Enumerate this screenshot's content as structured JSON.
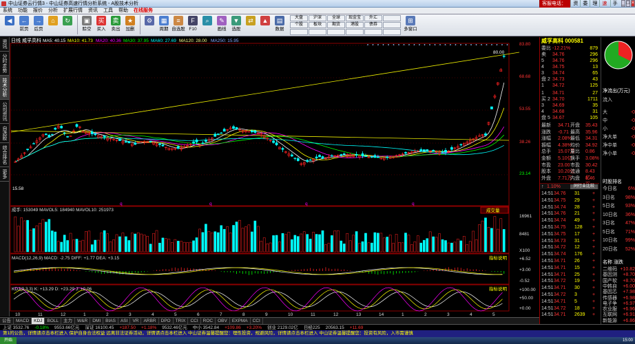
{
  "window": {
    "title": "中山证券云行情3 - 中山证券高速行情分析系统 - A股技术分析",
    "phone": "客服电话：4001022011",
    "links": [
      "资讯",
      "委托",
      "理财",
      "速帝盲盘",
      "手机炒股"
    ]
  },
  "menu": [
    "系统",
    "功能",
    "报价",
    "分析",
    "扩展行情",
    "资讯",
    "工具",
    "帮助",
    "在线服务"
  ],
  "toolbar": {
    "buttons": [
      "",
      "前页",
      "后页",
      "",
      "",
      "赊空",
      "买入",
      "卖出",
      "加删",
      "",
      "周期",
      "自选股",
      "F10",
      "",
      "画线",
      "选股",
      "",
      "",
      "数据"
    ],
    "grid": [
      "大盘",
      "沪深",
      "全球",
      "现金宝",
      "外汇",
      "",
      "个股",
      "板块",
      "期货",
      "港股",
      "债券",
      "",
      "",
      "",
      "",
      "",
      "",
      ""
    ],
    "extra": [
      "多窗口"
    ]
  },
  "leftnav": [
    "分时走势",
    "技术分析",
    "公司资讯",
    "自选股",
    "综合排名",
    "更多",
    "资讯"
  ],
  "header": {
    "period": "日线",
    "name": "威孚高科",
    "ma5": "MA5: 40.15",
    "ma10": "MA10: 41.73",
    "ma20": "MA20: 40.36",
    "ma30": "MA30: 37.95",
    "ma60": "MA60: 27.69",
    "ma120": "MA120: 28.00",
    "ma250": "MA250: 15.95"
  },
  "price_axis": [
    "83.80",
    "80.00",
    "68.68",
    "53.55",
    "38.26",
    "23.14"
  ],
  "price_marks": {
    "high": "80.00",
    "low": "15.58"
  },
  "vol_panel": {
    "header": "成手: 153049  MAVOL5: 184940  MAVOL10: 251973",
    "axis": [
      "16961",
      "8481",
      "X100"
    ],
    "tag": "成交量"
  },
  "macd_panel": {
    "header": "MACD(12,26,9)  MACD: -2.75  DIFF: +1.77  DEA: +3.15",
    "axis": [
      "+6.52",
      "+3.00",
      "-0.52"
    ],
    "tag": "指标说明"
  },
  "kdj_panel": {
    "header": "KDJ(9,3,3)  K: +13.29  D: +23.29  J: +0.06",
    "axis": [
      "+100.00",
      "+50.00",
      "+0.00"
    ],
    "tag": "指标说明"
  },
  "date_axis": [
    "10",
    "11",
    "12",
    "1",
    "2",
    "3",
    "4",
    "5",
    "6",
    "7",
    "8",
    "9",
    "10",
    "11",
    "12",
    "13",
    "14",
    "1",
    "2",
    "3",
    "4",
    "5"
  ],
  "q_marks": [
    "q",
    "q",
    "q",
    "q"
  ],
  "bottom_tabs": [
    "公告",
    "MACD",
    "KDJ",
    "BOLL",
    "主力",
    "W&R",
    "DMI",
    "BIAS",
    "ASI",
    "VR",
    "ARBR",
    "DPO",
    "TRIX",
    "CCI",
    "ROC",
    "OBV",
    "EXPMA",
    "CCI"
  ],
  "active_tab": "KDJ",
  "quote": {
    "title": "威孚高科 000581",
    "ratio_label": "委比",
    "ratio": "-12.21%",
    "diff": "879",
    "sell": [
      {
        "l": "卖",
        "p": "34.76",
        "v": "296"
      },
      {
        "l": "5",
        "p": "34.76",
        "v": "296"
      },
      {
        "l": "4",
        "p": "34.75",
        "v": "13"
      },
      {
        "l": "3",
        "p": "34.74",
        "v": "65"
      },
      {
        "l": "盘 2",
        "p": "34.73",
        "v": "43"
      },
      {
        "l": "1",
        "p": "34.72",
        "v": "125"
      }
    ],
    "buy": [
      {
        "l": "1",
        "p": "34.71",
        "v": "27"
      },
      {
        "l": "买 2",
        "p": "34.70",
        "v": "1711"
      },
      {
        "l": "3",
        "p": "34.69",
        "v": "35"
      },
      {
        "l": "4",
        "p": "34.68",
        "v": "31"
      },
      {
        "l": "盘 5",
        "p": "34.67",
        "v": "105"
      }
    ],
    "stats": [
      [
        "最新",
        "34.71",
        "开盘",
        "35.43"
      ],
      [
        "涨跌",
        "-0.71",
        "最高",
        "35.96"
      ],
      [
        "涨幅",
        "2.08%",
        "最低",
        "34.31"
      ],
      [
        "振幅",
        "4.38%",
        "均价",
        "34.92"
      ],
      [
        "总手",
        "15.07万",
        "量比",
        "0.86"
      ],
      [
        "金额",
        "5.10亿",
        "换手",
        "3.08%"
      ],
      [
        "市盈",
        "23.00",
        "市盈",
        "30.42"
      ],
      [
        "股本",
        "10.20亿",
        "流通",
        "8.43亿"
      ],
      [
        "外盘",
        "7.71万",
        "内盘",
        "8.46万"
      ]
    ],
    "bar_text": "1.10%",
    "ind_btn": "同行业比较",
    "ticks": [
      [
        "14:51",
        "34.76",
        "31",
        "+"
      ],
      [
        "14:51",
        "34.75",
        "29",
        "+"
      ],
      [
        "14:51",
        "34.74",
        "28",
        "+"
      ],
      [
        "14:51",
        "34.76",
        "21",
        "+"
      ],
      [
        "14:51",
        "34.74",
        "49",
        "+"
      ],
      [
        "14:51",
        "34.75",
        "128",
        "+"
      ],
      [
        "14:51",
        "34.75",
        "17",
        "+"
      ],
      [
        "14:51",
        "34.73",
        "31",
        "+"
      ],
      [
        "14:51",
        "34.72",
        "12",
        "+"
      ],
      [
        "14:51",
        "34.74",
        "176",
        "+"
      ],
      [
        "14:51",
        "34.71",
        "26",
        "+"
      ],
      [
        "14:51",
        "34.71",
        "15",
        "+"
      ],
      [
        "14:51",
        "34.71",
        "25",
        "+"
      ],
      [
        "14:51",
        "34.72",
        "19",
        "+"
      ],
      [
        "14:51",
        "34.71",
        "30",
        "+"
      ],
      [
        "14:51",
        "34.72",
        "3",
        "+"
      ],
      [
        "14:51",
        "34.71",
        "5",
        "+"
      ],
      [
        "14:51",
        "34.72",
        "18",
        "+"
      ],
      [
        "14:51",
        "34.71",
        "2639",
        "+"
      ]
    ]
  },
  "rightpanel": {
    "flow_title": "净流出(万元)",
    "flow_sub": "流入",
    "flow": [
      [
        "大",
        "-0"
      ],
      [
        "中",
        "-0"
      ],
      [
        "小",
        "-0"
      ],
      [
        "净大单",
        "-0"
      ],
      [
        "净中单",
        "-0"
      ],
      [
        "净小单",
        "-0"
      ]
    ],
    "rank_title": "时股排名",
    "ranks": [
      [
        "今日名",
        "6%"
      ],
      [
        "3日名",
        "98%"
      ],
      [
        "5日名",
        "93%"
      ],
      [
        "10日名",
        "36%"
      ],
      [
        "3日名",
        "47%"
      ],
      [
        "5日名",
        "71%"
      ],
      [
        "10日名",
        "99%"
      ],
      [
        "20日名",
        "52%"
      ]
    ],
    "plates_title": "名称 涨跌",
    "plates": [
      [
        "二维码",
        "+10.82"
      ],
      [
        "基因测",
        "+8.70"
      ],
      [
        "国产软",
        "+8.70"
      ],
      [
        "中韩自",
        "+6.00"
      ],
      [
        "基因芯",
        "+7.98"
      ],
      [
        "传感器",
        "+6.98"
      ],
      [
        "电子争",
        "+6.97"
      ],
      [
        "农业服",
        "+6.96"
      ],
      [
        "互联网",
        "+6.91"
      ],
      [
        "新能源",
        "+6.86"
      ]
    ]
  },
  "status": [
    "上证 3532.76",
    "-0.18%",
    "9553.66亿元",
    "深证 16100.45",
    "+187.50",
    "+1.18%",
    "9532.46亿元",
    "中小 3542.84",
    "+109.86",
    "+3.20%",
    "创业 2129.02亿",
    "日经225",
    "20563.15",
    "+11.69"
  ],
  "ticker": "第1的公告，详情请点击本栏进入   保护自身合法权益 远离非法证券活动，详情请点击本栏进入   中山证券温馨提醒您：理性投资，规避风险，详情请点击本栏进入   中山证券温馨提醒您：投资有风险，入市需谨慎",
  "taskbar": {
    "start": "开始",
    "clock": "15:00"
  }
}
